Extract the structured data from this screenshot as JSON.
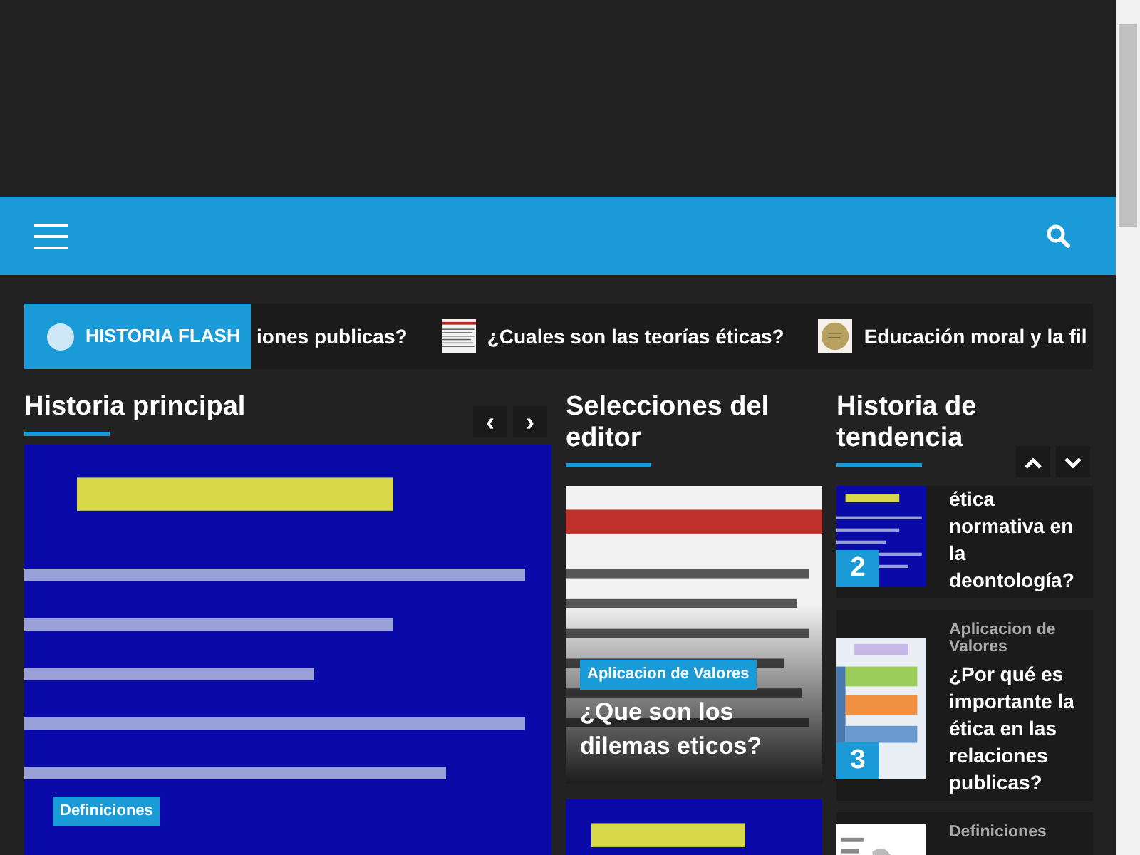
{
  "ticker": {
    "label": "HISTORIA FLASH",
    "items": [
      {
        "title": "iones publicas?"
      },
      {
        "title": "¿Cuales son las teorías éticas?",
        "thumbnail": {
          "kind": "picture"
        }
      },
      {
        "title": "Educación moral y la fil",
        "thumbnail": {
          "kind": "picture"
        }
      }
    ]
  },
  "main_story": {
    "heading": "Historia principal",
    "prev": "‹",
    "next": "›",
    "slide": {
      "kind": "picture",
      "category": "Definiciones"
    }
  },
  "editor_picks": {
    "heading": "Selecciones del editor",
    "items": [
      {
        "kind": "picture",
        "category": "Aplicacion de Valores",
        "title": "¿Que son los dilemas eticos?"
      },
      {
        "kind": "picture"
      }
    ]
  },
  "trending": {
    "heading": "Historia de tendencia",
    "items": [
      {
        "rank": "2",
        "title": "ética normativa en la deontología?"
      },
      {
        "rank": "3",
        "category": "Aplicacion de Valores",
        "title": "¿Por qué es importante la ética en las relaciones publicas?"
      },
      {
        "category": "Definiciones"
      }
    ]
  }
}
